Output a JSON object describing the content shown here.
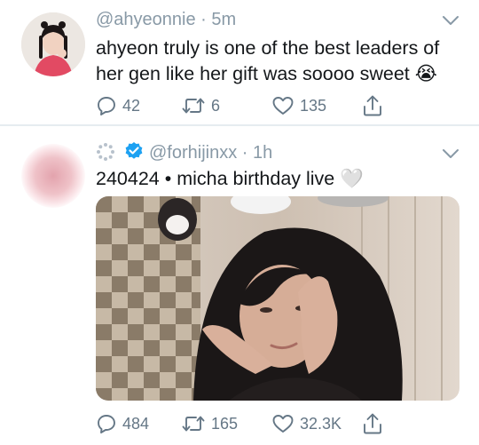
{
  "tweets": [
    {
      "handle": "@ahyeonnie",
      "separator": " · ",
      "time": "5m",
      "text": "ahyeon truly is one of the best leaders of her gen like her gift was soooo sweet 😭",
      "replies": "42",
      "retweets": "6",
      "likes": "135"
    },
    {
      "handle": "@forhijinxx",
      "separator": " · ",
      "time": "1h",
      "text": "240424 • micha birthday live 🤍",
      "replies": "484",
      "retweets": "165",
      "likes": "32.3K"
    }
  ],
  "icons": [
    "reply-icon",
    "retweet-icon",
    "like-icon",
    "share-icon",
    "chevron-down-icon",
    "verified-badge-icon",
    "loading-spinner-icon"
  ],
  "colors": {
    "secondary_text": "#8899a6",
    "icon_gray": "#657786",
    "verified_blue": "#1da1f2",
    "divider": "#e6ecf0"
  }
}
